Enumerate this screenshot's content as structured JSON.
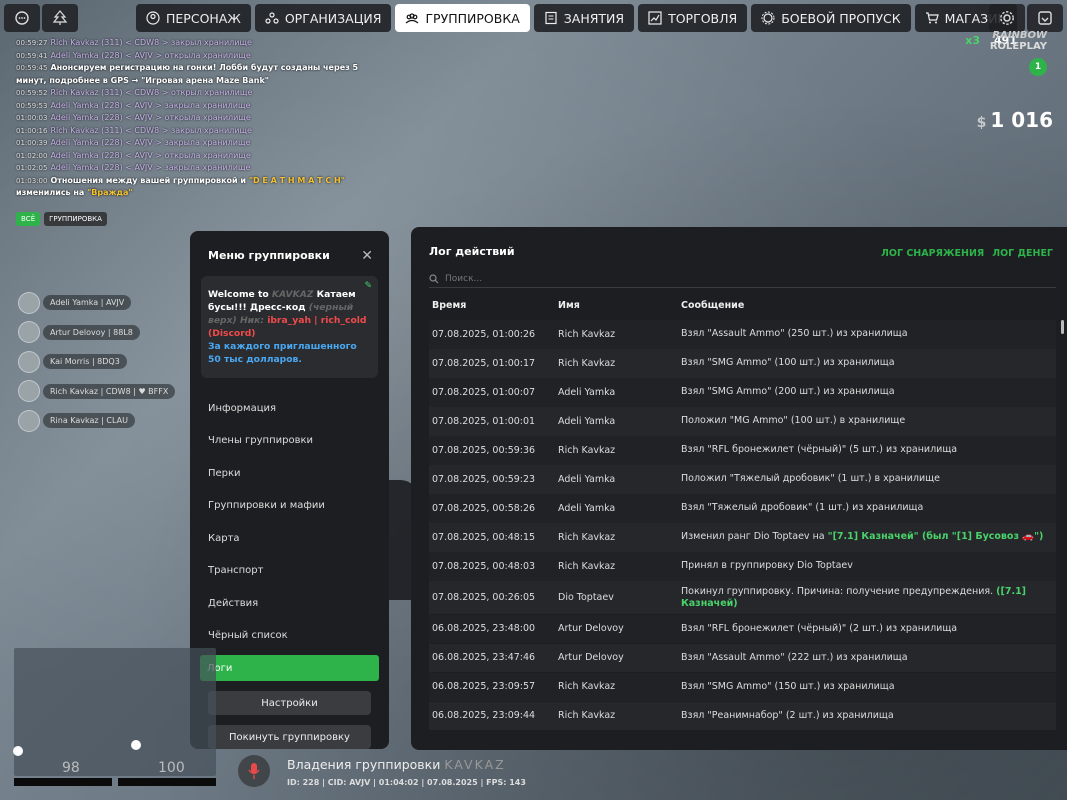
{
  "nav": {
    "tabs": [
      {
        "label": "ПЕРСОНАЖ"
      },
      {
        "label": "ОРГАНИЗАЦИЯ"
      },
      {
        "label": "ГРУППИРОВКА"
      },
      {
        "label": "ЗАНЯТИЯ"
      },
      {
        "label": "ТОРГОВЛЯ"
      },
      {
        "label": "БОЕВОЙ ПРОПУСК"
      },
      {
        "label": "МАГАЗИН"
      }
    ]
  },
  "hud": {
    "multiplier": "x3",
    "points": "491",
    "logo_line1": "RAINBOW",
    "logo_line2": "ROLEPLAY",
    "level": "1",
    "money_symbol": "$",
    "money": "1 016"
  },
  "chat": {
    "lines": [
      {
        "time": "00:59:27",
        "text": "Rich Kavkaz (311) < CDW8 > закрыл хранилище"
      },
      {
        "time": "00:59:41",
        "text": "Adeli Yamka (228) < AVJV > открыла хранилище"
      },
      {
        "time": "00:59:45",
        "text": "Анонсируем регистрацию на гонки! Лобби будут созданы через 5 минут, подробнее в GPS → \"Игровая арена Maze Bank\""
      },
      {
        "time": "00:59:52",
        "text": "Rich Kavkaz (311) < CDW8 > открыл хранилище"
      },
      {
        "time": "00:59:53",
        "text": "Adeli Yamka (228) < AVJV > закрыла хранилище"
      },
      {
        "time": "01:00:03",
        "text": "Adeli Yamka (228) < AVJV > открыла хранилище"
      },
      {
        "time": "01:00:16",
        "text": "Rich Kavkaz (311) < CDW8 > закрыл хранилище"
      },
      {
        "time": "01:00:39",
        "text": "Adeli Yamka (228) < AVJV > закрыла хранилище"
      },
      {
        "time": "01:02:00",
        "text": "Adeli Yamka (228) < AVJV > открыла хранилище"
      },
      {
        "time": "01:02:05",
        "text": "Adeli Yamka (228) < AVJV > закрыла хранилище"
      }
    ],
    "relation_time": "01:03:00",
    "relation_prefix": "Отношения между вашей группировкой и ",
    "relation_gang": "\"D E A T H M A T C H\"",
    "relation_mid": " изменились на ",
    "relation_value": "\"Вражда\"",
    "tab_all": "ВСЁ",
    "tab_group": "ГРУППИРОВКА"
  },
  "players": [
    {
      "name": "Adeli Yamka | AVJV"
    },
    {
      "name": "Artur Delovoy | 88L8"
    },
    {
      "name": "Kai Morris | 8DQ3"
    },
    {
      "name": "Rich Kavkaz | CDW8 | ♥ BFFX"
    },
    {
      "name": "Rina Kavkaz | CLAU"
    }
  ],
  "menu": {
    "title": "Меню группировки",
    "motd_1": "Welcome to ",
    "motd_gang": "KAVKAZ",
    "motd_2": " Катаем бусы!!! Дресс-код ",
    "motd_dress": "(черный верх) ",
    "motd_3": "Ник: ",
    "motd_nick": "ibra_yah | rich_cold (Discord)",
    "motd_4": "За каждого приглашенного 50 тыс долларов.",
    "items": [
      {
        "label": "Информация"
      },
      {
        "label": "Члены группировки"
      },
      {
        "label": "Перки"
      },
      {
        "label": "Группировки и мафии"
      },
      {
        "label": "Карта"
      },
      {
        "label": "Транспорт"
      },
      {
        "label": "Действия"
      },
      {
        "label": "Чёрный список"
      },
      {
        "label": "Логи"
      }
    ],
    "settings": "Настройки",
    "leave": "Покинуть группировку"
  },
  "log": {
    "title": "Лог действий",
    "link_equip": "ЛОГ СНАРЯЖЕНИЯ",
    "link_money": "ЛОГ ДЕНЕГ",
    "search_placeholder": "Поиск...",
    "col_time": "Время",
    "col_name": "Имя",
    "col_msg": "Сообщение",
    "rows": [
      {
        "time": "07.08.2025, 01:00:26",
        "name": "Rich Kavkaz",
        "msg": "Взял \"Assault Ammo\" (250 шт.) из хранилища"
      },
      {
        "time": "07.08.2025, 01:00:17",
        "name": "Rich Kavkaz",
        "msg": "Взял \"SMG Ammo\" (100 шт.) из хранилища"
      },
      {
        "time": "07.08.2025, 01:00:07",
        "name": "Adeli Yamka",
        "msg": "Взял \"SMG Ammo\" (200 шт.) из хранилища"
      },
      {
        "time": "07.08.2025, 01:00:01",
        "name": "Adeli Yamka",
        "msg": "Положил \"MG Ammo\" (100 шт.) в хранилище"
      },
      {
        "time": "07.08.2025, 00:59:36",
        "name": "Rich Kavkaz",
        "msg": "Взял \"RFL бронежилет (чёрный)\" (5 шт.) из хранилища"
      },
      {
        "time": "07.08.2025, 00:59:23",
        "name": "Adeli Yamka",
        "msg": "Положил \"Тяжелый дробовик\" (1 шт.) в хранилище"
      },
      {
        "time": "07.08.2025, 00:58:26",
        "name": "Adeli Yamka",
        "msg": "Взял \"Тяжелый дробовик\" (1 шт.) из хранилища"
      },
      {
        "time": "07.08.2025, 00:48:15",
        "name": "Rich Kavkaz",
        "msg_a": "Изменил ранг Dio Toptaev на ",
        "msg_b": "\"[7.1] Казначей\" (был \"[1] Бусовоз 🚗\")"
      },
      {
        "time": "07.08.2025, 00:48:03",
        "name": "Rich Kavkaz",
        "msg": "Принял в группировку Dio Toptaev"
      },
      {
        "time": "07.08.2025, 00:26:05",
        "name": "Dio Toptaev",
        "msg_a": "Покинул группировку. Причина: получение предупреждения. ",
        "msg_b": "([7.1] Казначей)"
      },
      {
        "time": "06.08.2025, 23:48:00",
        "name": "Artur Delovoy",
        "msg": "Взял \"RFL бронежилет (чёрный)\" (2 шт.) из хранилища"
      },
      {
        "time": "06.08.2025, 23:47:46",
        "name": "Artur Delovoy",
        "msg": "Взял \"Assault Ammo\" (222 шт.) из хранилища"
      },
      {
        "time": "06.08.2025, 23:09:57",
        "name": "Rich Kavkaz",
        "msg": "Взял \"SMG Ammo\" (150 шт.) из хранилища"
      },
      {
        "time": "06.08.2025, 23:09:44",
        "name": "Rich Kavkaz",
        "msg": "Взял \"Реанимнабор\" (2 шт.) из хранилища"
      }
    ]
  },
  "bottom": {
    "hp": "98",
    "armor": "100",
    "zone_label": "Владения группировки",
    "zone_gang": "KAVKAZ",
    "info": "ID: 228 | CID: AVJV | 01:04:02 | 07.08.2025 | FPS: 143"
  }
}
